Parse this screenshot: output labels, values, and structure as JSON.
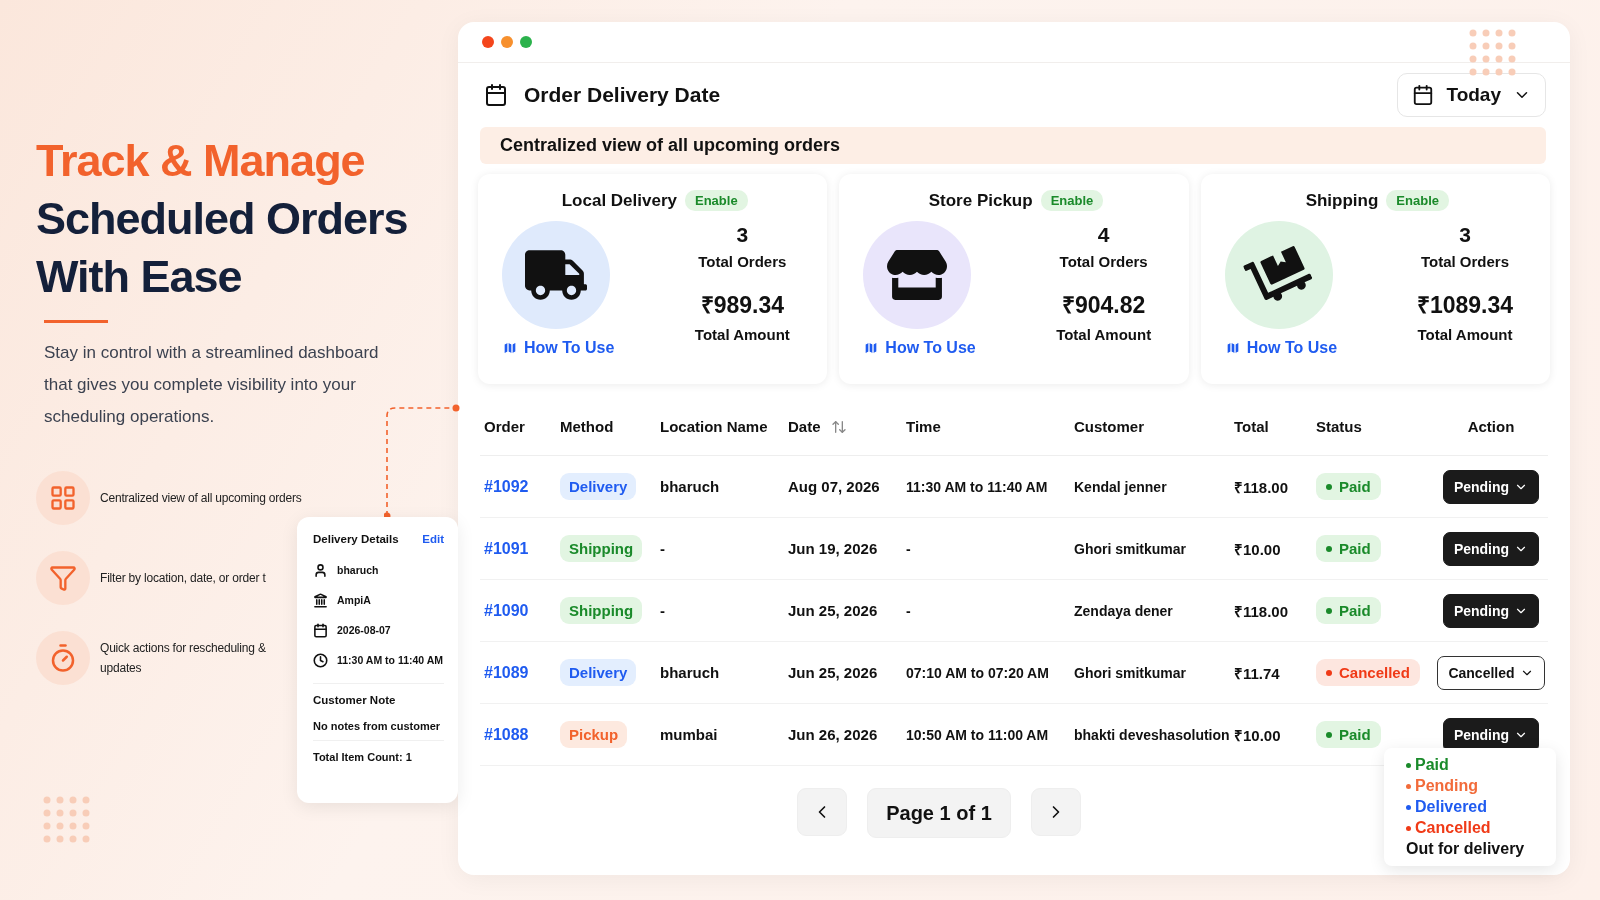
{
  "hero": {
    "title_accent": "Track & Manage",
    "title_lines": [
      "Scheduled Orders",
      "With Ease"
    ],
    "description": "Stay in control with a streamlined dashboard that gives you complete visibility into your scheduling operations.",
    "features": [
      {
        "kind": "grid",
        "text": "Centralized view of all upcoming orders"
      },
      {
        "kind": "filter",
        "text": "Filter by location, date, or order t"
      },
      {
        "kind": "timer",
        "text": "Quick actions for rescheduling & updates"
      }
    ]
  },
  "details_card": {
    "title": "Delivery Details",
    "edit": "Edit",
    "rows": [
      {
        "kind": "person",
        "text": "bharuch"
      },
      {
        "kind": "building",
        "text": "AmpiA"
      },
      {
        "kind": "calendar",
        "text": "2026-08-07"
      },
      {
        "kind": "clock",
        "text": "11:30 AM to 11:40 AM"
      }
    ],
    "note_title": "Customer Note",
    "note": "No notes from customer",
    "item_count": "Total Item Count: 1"
  },
  "window": {
    "title": "Order Delivery Date",
    "date_filter": "Today",
    "banner": "Centralized view of all upcoming orders",
    "cards": [
      {
        "kind": "truck",
        "title": "Local Delivery",
        "badge": "Enable",
        "orders": "3",
        "orders_label": "Total Orders",
        "amount": "₹989.34",
        "amount_label": "Total Amount",
        "help": "How To Use"
      },
      {
        "kind": "store",
        "title": "Store Pickup",
        "badge": "Enable",
        "orders": "4",
        "orders_label": "Total Orders",
        "amount": "₹904.82",
        "amount_label": "Total Amount",
        "help": "How To Use"
      },
      {
        "kind": "dolly",
        "title": "Shipping",
        "badge": "Enable",
        "orders": "3",
        "orders_label": "Total Orders",
        "amount": "₹1089.34",
        "amount_label": "Total Amount",
        "help": "How To Use"
      }
    ],
    "table": {
      "columns": [
        {
          "label": "Order",
          "sortable": false
        },
        {
          "label": "Method",
          "sortable": false
        },
        {
          "label": "Location Name",
          "sortable": false
        },
        {
          "label": "Date",
          "sortable": true
        },
        {
          "label": "Time",
          "sortable": false
        },
        {
          "label": "Customer",
          "sortable": false
        },
        {
          "label": "Total",
          "sortable": false
        },
        {
          "label": "Status",
          "sortable": false
        },
        {
          "label": "Action",
          "sortable": false
        }
      ],
      "rows": [
        {
          "order": "#1092",
          "method": {
            "label": "Delivery",
            "kind": "delivery"
          },
          "location": "bharuch",
          "date": "Aug 07, 2026",
          "time": "11:30 AM to 11:40 AM",
          "customer": "Kendal jenner",
          "total": "₹118.00",
          "status": {
            "label": "Paid",
            "kind": "paid"
          },
          "action": {
            "label": "Pending",
            "kind": "filled"
          }
        },
        {
          "order": "#1091",
          "method": {
            "label": "Shipping",
            "kind": "shipping"
          },
          "location": "-",
          "date": "Jun 19, 2026",
          "time": "-",
          "customer": "Ghori smitkumar",
          "total": "₹10.00",
          "status": {
            "label": "Paid",
            "kind": "paid"
          },
          "action": {
            "label": "Pending",
            "kind": "filled"
          }
        },
        {
          "order": "#1090",
          "method": {
            "label": "Shipping",
            "kind": "shipping"
          },
          "location": "-",
          "date": "Jun 25, 2026",
          "time": "-",
          "customer": "Zendaya dener",
          "total": "₹118.00",
          "status": {
            "label": "Paid",
            "kind": "paid"
          },
          "action": {
            "label": "Pending",
            "kind": "filled"
          }
        },
        {
          "order": "#1089",
          "method": {
            "label": "Delivery",
            "kind": "delivery"
          },
          "location": "bharuch",
          "date": "Jun 25, 2026",
          "time": "07:10 AM to 07:20 AM",
          "customer": "Ghori smitkumar",
          "total": "₹11.74",
          "status": {
            "label": "Cancelled",
            "kind": "cancelled"
          },
          "action": {
            "label": "Cancelled",
            "kind": "outline"
          }
        },
        {
          "order": "#1088",
          "method": {
            "label": "Pickup",
            "kind": "pickup"
          },
          "location": "mumbai",
          "date": "Jun 26, 2026",
          "time": "10:50 AM to 11:00 AM",
          "customer": "bhakti deveshasolution",
          "total": "₹10.00",
          "status": {
            "label": "Paid",
            "kind": "paid"
          },
          "action": {
            "label": "Pending",
            "kind": "filled"
          }
        }
      ]
    },
    "pagination": {
      "label": "Page 1 of 1"
    },
    "status_menu": [
      {
        "label": "Paid",
        "color": "#1a8a2a"
      },
      {
        "label": "Pending",
        "color": "#f26b3a"
      },
      {
        "label": "Delivered",
        "color": "#1f5bf0"
      },
      {
        "label": "Cancelled",
        "color": "#f03a17"
      },
      {
        "label": "Out for delivery"
      }
    ]
  }
}
